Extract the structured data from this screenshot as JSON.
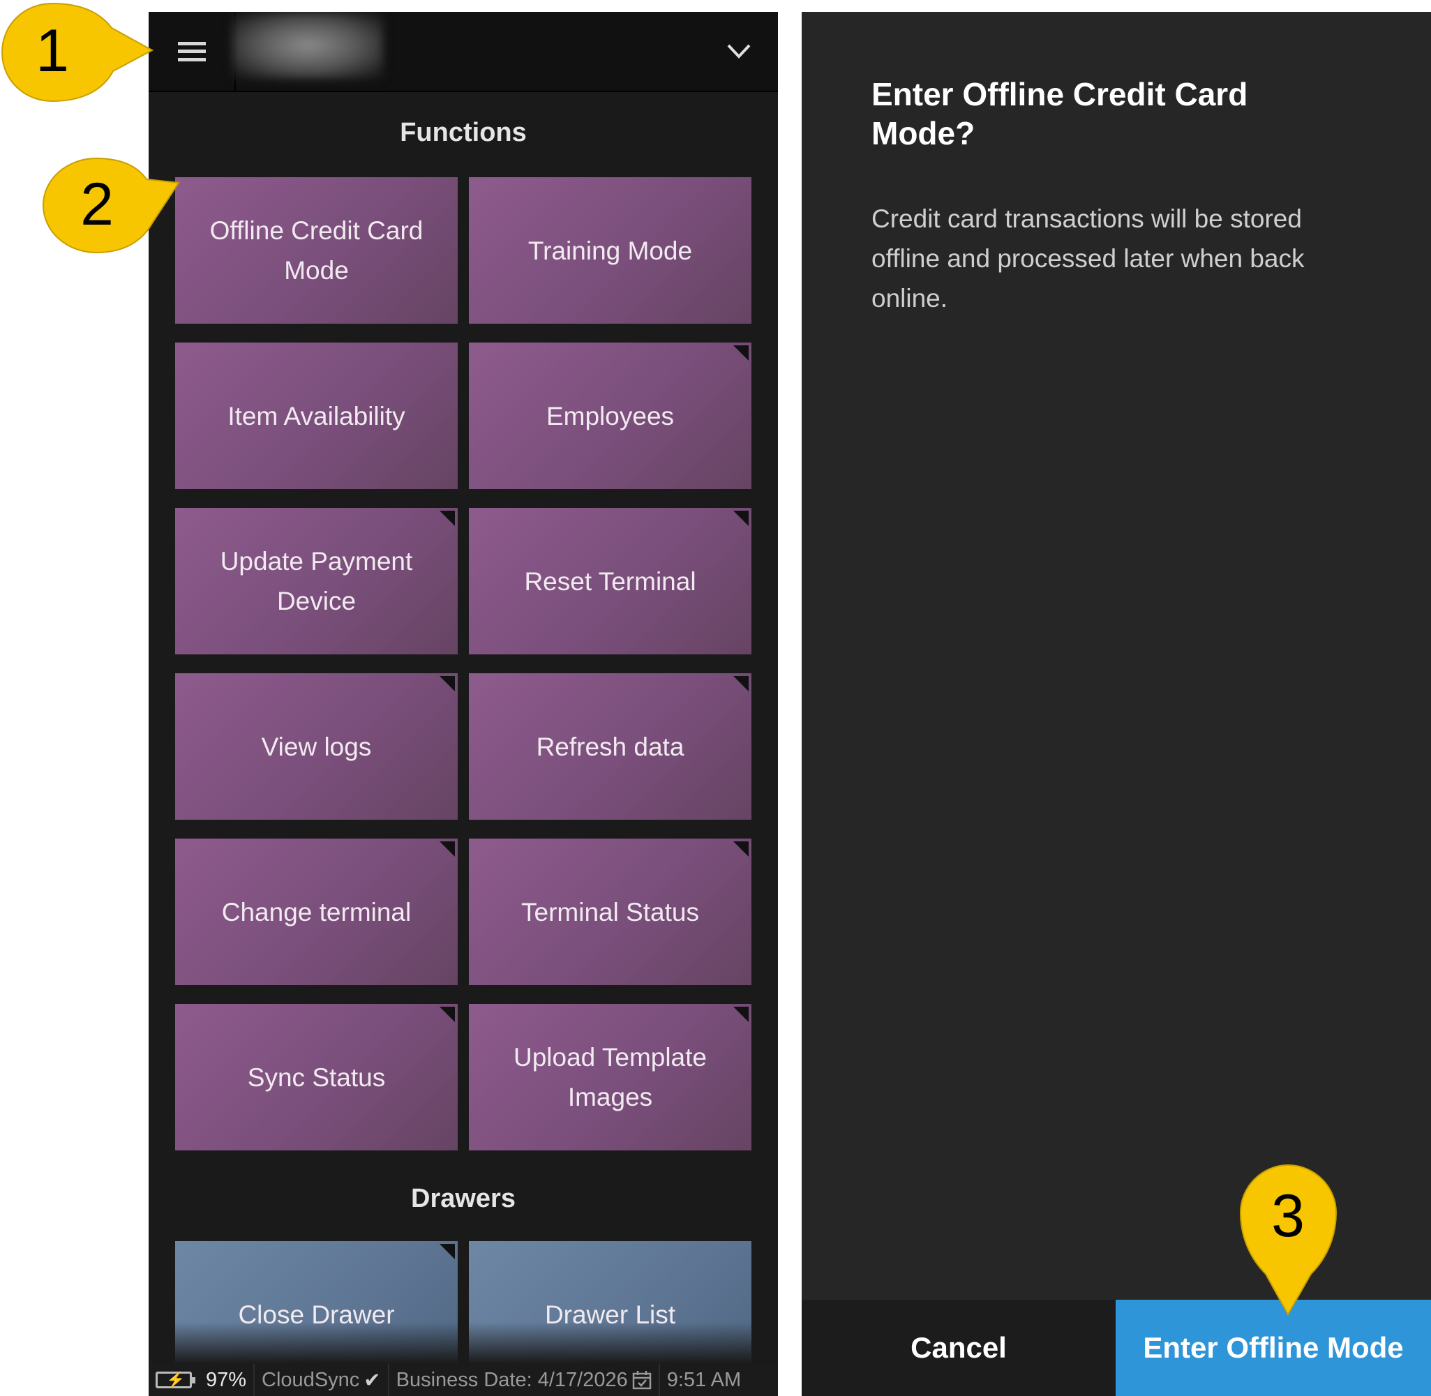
{
  "left_screen": {
    "functions_title": "Functions",
    "function_tiles": [
      {
        "label": "Offline Credit Card Mode",
        "submenu": false
      },
      {
        "label": "Training Mode",
        "submenu": false
      },
      {
        "label": "Item Availability",
        "submenu": false
      },
      {
        "label": "Employees",
        "submenu": true
      },
      {
        "label": "Update Payment Device",
        "submenu": true
      },
      {
        "label": "Reset Terminal",
        "submenu": true
      },
      {
        "label": "View logs",
        "submenu": true
      },
      {
        "label": "Refresh data",
        "submenu": true
      },
      {
        "label": "Change terminal",
        "submenu": true
      },
      {
        "label": "Terminal Status",
        "submenu": true
      },
      {
        "label": "Sync Status",
        "submenu": true
      },
      {
        "label": "Upload Template Images",
        "submenu": true
      }
    ],
    "drawers_title": "Drawers",
    "drawer_tiles": [
      {
        "label": "Close Drawer",
        "submenu": true
      },
      {
        "label": "Drawer List",
        "submenu": false
      }
    ],
    "status_bar": {
      "battery": "97%",
      "cloud_sync": "CloudSync",
      "business_date": "Business Date: 4/17/2026",
      "time": "9:51 AM"
    },
    "tile_color": "#7f527f",
    "drawer_tile_color": "#5f7896"
  },
  "right_screen": {
    "dialog_title": "Enter Offline Credit Card Mode?",
    "dialog_body": "Credit card transactions will be stored offline and processed later when back online.",
    "cancel_label": "Cancel",
    "confirm_label": "Enter Offline Mode",
    "confirm_color": "#2e95d8"
  },
  "callouts": [
    {
      "number": "1"
    },
    {
      "number": "2"
    },
    {
      "number": "3"
    }
  ],
  "callout_color": "#f7c600"
}
